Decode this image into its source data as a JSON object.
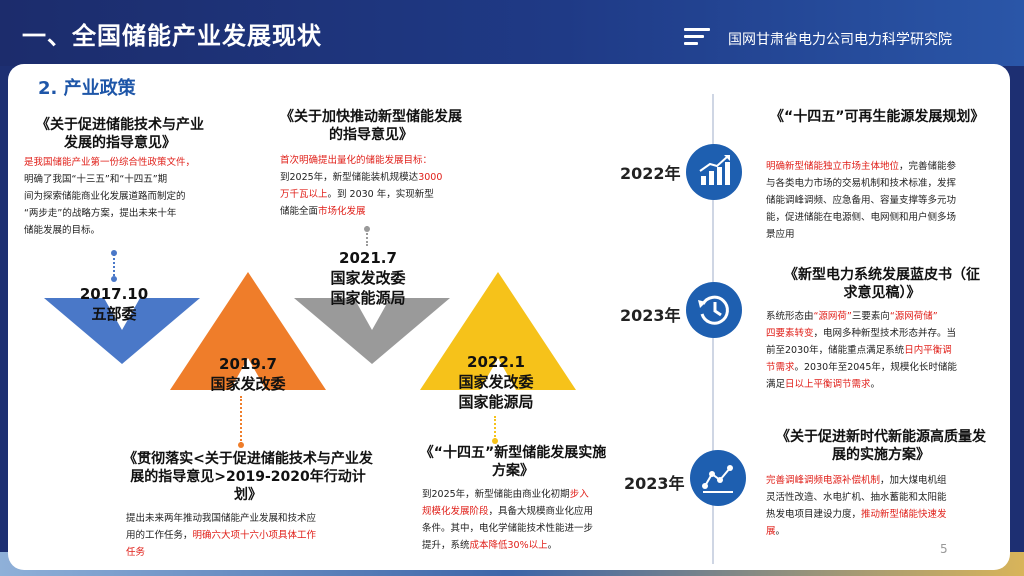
{
  "header": {
    "title": "一、全国储能产业发展现状",
    "company": "国网甘肃省电力公司电力科学研究院"
  },
  "section": {
    "subtitle": "2. 产业政策"
  },
  "timeline_left": [
    {
      "title": "《关于促进储能技术与产业发展的指导意见》",
      "body_lines": [
        [
          {
            "t": "是我国储能产业第一份综合性政策文件，",
            "red": true
          }
        ],
        [
          {
            "t": "明确了我国“十三五”和“十四五”期"
          }
        ],
        [
          {
            "t": "间为探索储能商业化发展道路而制定的"
          }
        ],
        [
          {
            "t": "“两步走”的战略方案，提出未来十年"
          }
        ],
        [
          {
            "t": "储能发展的目标。"
          }
        ]
      ],
      "date": "2017.10",
      "issuer": [
        "五部委"
      ]
    },
    {
      "title": "《贯彻落实<关于促进储能技术与产业发展的指导意见>2019-2020年行动计划》",
      "body_lines": [
        [
          {
            "t": "提出未来两年推动我国储能产业发展和技术应"
          }
        ],
        [
          {
            "t": "用的工作任务，"
          },
          {
            "t": "明确六大项十六小项具体工作",
            "red": true
          }
        ],
        [
          {
            "t": "任务",
            "red": true
          }
        ]
      ],
      "date": "2019.7",
      "issuer": [
        "国家发改委"
      ]
    },
    {
      "title": "《关于加快推动新型储能发展的指导意见》",
      "body_lines": [
        [
          {
            "t": "首次明确提出量化的储能发展目标：",
            "red": true
          }
        ],
        [
          {
            "t": "到2025年，新型储能装机规模达"
          },
          {
            "t": "3000",
            "red": true
          }
        ],
        [
          {
            "t": "万千瓦以上",
            "red": true
          },
          {
            "t": "。到 2030 年，实现新型"
          }
        ],
        [
          {
            "t": "储能全面"
          },
          {
            "t": "市场化发展",
            "red": true
          }
        ]
      ],
      "date": "2021.7",
      "issuer": [
        "国家发改委",
        "国家能源局"
      ]
    },
    {
      "title": "《“十四五”新型储能发展实施方案》",
      "body_lines": [
        [
          {
            "t": "到2025年，新型储能由商业化初期"
          },
          {
            "t": "步入",
            "red": true
          }
        ],
        [
          {
            "t": "规模化发展阶段",
            "red": true
          },
          {
            "t": "，具备大规模商业化应用"
          }
        ],
        [
          {
            "t": "条件。其中，电化学储能技术性能进一步"
          }
        ],
        [
          {
            "t": "提升，系统"
          },
          {
            "t": "成本降低30%以上",
            "red": true
          },
          {
            "t": "。"
          }
        ]
      ],
      "date": "2022.1",
      "issuer": [
        "国家发改委",
        "国家能源局"
      ]
    }
  ],
  "timeline_right": [
    {
      "year": "2022年",
      "icon": "chart-growth-icon",
      "title": "《“十四五”可再生能源发展规划》",
      "body_lines": [
        [
          {
            "t": "明确新型储能独立市场主体地位",
            "red": true
          },
          {
            "t": "，完善储能参"
          }
        ],
        [
          {
            "t": "与各类电力市场的交易机制和技术标准，发挥"
          }
        ],
        [
          {
            "t": "储能调峰调频、应急备用、容量支撑等多元功"
          }
        ],
        [
          {
            "t": "能，促进储能在电源侧、电网侧和用户侧多场"
          }
        ],
        [
          {
            "t": "景应用"
          }
        ]
      ]
    },
    {
      "year": "2023年",
      "icon": "history-clock-icon",
      "title": "《新型电力系统发展蓝皮书（征求意见稿）》",
      "body_lines": [
        [
          {
            "t": "系统形态由"
          },
          {
            "t": "“源网荷”",
            "red": true
          },
          {
            "t": "三要素向"
          },
          {
            "t": "“源网荷储”",
            "red": true
          }
        ],
        [
          {
            "t": "四要素转变",
            "red": true
          },
          {
            "t": "，电网多种新型技术形态并存。当"
          }
        ],
        [
          {
            "t": "前至2030年，储能重点满足系统"
          },
          {
            "t": "日内平衡调",
            "red": true
          }
        ],
        [
          {
            "t": "节需求",
            "red": true
          },
          {
            "t": "。2030年至2045年，规模化长时储能"
          }
        ],
        [
          {
            "t": "满足"
          },
          {
            "t": "日以上平衡调节需求",
            "red": true
          },
          {
            "t": "。"
          }
        ]
      ]
    },
    {
      "year": "2023年",
      "icon": "network-analytics-icon",
      "title": "《关于促进新时代新能源高质量发展的实施方案》",
      "body_lines": [
        [
          {
            "t": "完善调峰调频电源补偿机制",
            "red": true
          },
          {
            "t": "，加大煤电机组"
          }
        ],
        [
          {
            "t": "灵活性改造、水电扩机、抽水蓄能和太阳能"
          }
        ],
        [
          {
            "t": "热发电项目建设力度，"
          },
          {
            "t": "推动新型储能快速发",
            "red": true
          }
        ],
        [
          {
            "t": "展",
            "red": true
          },
          {
            "t": "。"
          }
        ]
      ]
    }
  ],
  "page_number": "5",
  "colors": {
    "header_bg": "#1f3a86",
    "accent_blue": "#1e5fb0",
    "red_text": "#e0201a",
    "chevron_blue": "#4a78c8",
    "chevron_orange": "#ef7d2a",
    "chevron_gray": "#9a9a9a",
    "chevron_yellow": "#f6c21a"
  }
}
